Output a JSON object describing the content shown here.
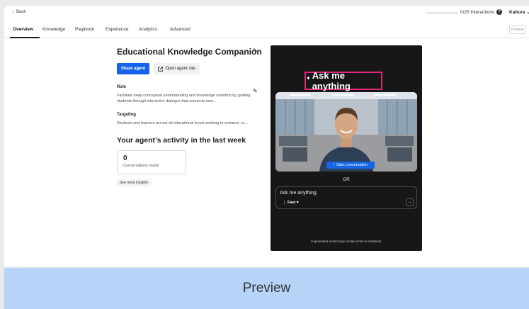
{
  "topbar": {
    "back_label": "Back",
    "interactions_label": "0/25 Interactions",
    "interactions_fraction": 0,
    "brand": "Kaltura"
  },
  "tabs": [
    {
      "label": "Overview",
      "active": true
    },
    {
      "label": "Knowledge"
    },
    {
      "label": "Playbook"
    },
    {
      "label": "Experience"
    },
    {
      "label": "Analytics"
    },
    {
      "label": "Advanced"
    }
  ],
  "publish_label": "Publish",
  "agent": {
    "title": "Educational Knowledge Companion",
    "share_label": "Share agent",
    "open_site_label": "Open agent site",
    "role_label": "Role",
    "role_text": "Facilitate deep conceptual understanding and knowledge retention by guiding students through interactive dialogue that connects new...",
    "targeting_label": "Targeting",
    "targeting_text": "Students and learners across all educational levels seeking to enhance co..."
  },
  "activity": {
    "title": "Your agent’s activity in the last week",
    "conversations_count": "0",
    "conversations_label": "Conversations made",
    "insights_label": "See more insights"
  },
  "preview_phone": {
    "headline": "Ask me anything",
    "start_label": "Start conversation",
    "or_label": "OR",
    "chat_placeholder": "Ask me anything",
    "mode_label": "Fast",
    "disclaimer": "AI-generated content may contain errors or omissions."
  },
  "preview_bar_label": "Preview",
  "colors": {
    "accent": "#1463e8",
    "highlight": "#e0257a",
    "preview_bg": "#b7d3f7"
  }
}
